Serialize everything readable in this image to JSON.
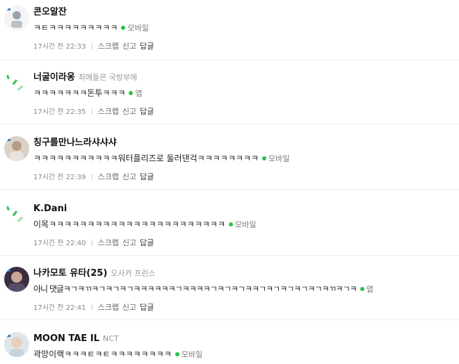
{
  "comments": [
    {
      "nickname": "콘오알잔",
      "badge": "",
      "text": "ㅋㅌㅋㅋㅋㅋㅋㅋㅋㅋㅋ",
      "device": "모바일",
      "time": "17시간 전",
      "clock": "22:33",
      "avatar": "photo"
    },
    {
      "nickname": "너굴이라옹",
      "badge": "최애들은 국방부에",
      "text": "ㅋㅋㅋㅋㅋㅋㅋ돈투ㅋㅋㅋ",
      "device": "앱",
      "time": "17시간 전",
      "clock": "22:35",
      "avatar": "default"
    },
    {
      "nickname": "칭구를만나느라샤샤샤",
      "badge": "",
      "text": "ㅋㅋㅋㅋㅋㅋㅋㅋㅋㅋㅋ워터플리즈로 둘러댄걱ㅋㅋㅋㅋㅋㅋㅋㅋ",
      "device": "모바일",
      "time": "17시간 전",
      "clock": "22:39",
      "avatar": "photo"
    },
    {
      "nickname": "K.Dani",
      "badge": "",
      "text": "이목ㅋㅋㅋㅋㅋㅋㅋㅋㅋㅋㅋㅋㅋㅋㅋㅋㅋㅋㅋㅋㅋㅋㅋ",
      "device": "모바일",
      "time": "17시간 전",
      "clock": "22:40",
      "avatar": "default"
    },
    {
      "nickname": "나카모토 유타(25)",
      "badge": "오사카 프린스",
      "text": "아니 댓글ㅋㄱㅋㄲㅋㄱㅋㄱㅋㄱㅋㅋㅋㅋㅋㅋㄱㅋㅋㅋㅋㄱㅋㄱㅋㄱㅋㅋㄱㅋㄱㅋㄱㅋㄱㅋㄱㅋㄲㅋㄱㅋ",
      "device": "앱",
      "time": "17시간 전",
      "clock": "22:41",
      "avatar": "photo"
    },
    {
      "nickname": "MOON TAE IL",
      "badge": "NCT",
      "text": "곽망이랙ㅋㅋㅋㅌㅋㅌㅋㅋㅋㅋㅋㅋㅋㅋ",
      "device": "모바일",
      "time": "",
      "clock": "",
      "avatar": "photo"
    }
  ],
  "actions": {
    "scrap": "스크랩",
    "report": "신고",
    "reply": "답글"
  },
  "colors": {
    "device_dot": "#2cc24a",
    "default_avatar_green": "#33c24d"
  }
}
